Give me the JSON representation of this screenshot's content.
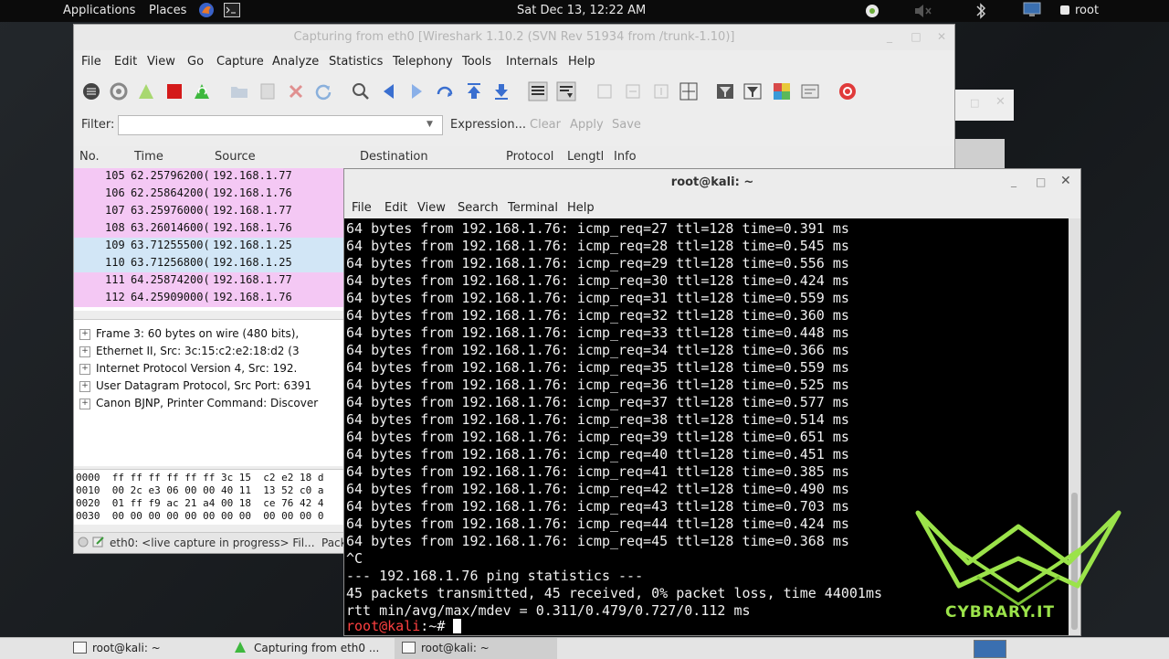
{
  "top_panel": {
    "applications": "Applications",
    "places": "Places",
    "clock": "Sat Dec 13, 12:22 AM",
    "user": "root"
  },
  "wireshark": {
    "title": "Capturing from eth0   [Wireshark 1.10.2  (SVN Rev 51934 from /trunk-1.10)]",
    "menu": [
      "File",
      "Edit",
      "View",
      "Go",
      "Capture",
      "Analyze",
      "Statistics",
      "Telephony",
      "Tools",
      "Internals",
      "Help"
    ],
    "filter_label": "Filter:",
    "filter_value": "",
    "expression_label": "Expression...",
    "clear_label": "Clear",
    "apply_label": "Apply",
    "save_label": "Save",
    "columns": [
      "No.",
      "Time",
      "Source",
      "Destination",
      "Protocol",
      "Lengtl",
      "Info"
    ],
    "packets": [
      {
        "no": "105",
        "time": "62.25796200(",
        "source": "192.168.1.77",
        "color": "#f4c8f4"
      },
      {
        "no": "106",
        "time": "62.25864200(",
        "source": "192.168.1.76",
        "color": "#f4c8f4"
      },
      {
        "no": "107",
        "time": "63.25976000(",
        "source": "192.168.1.77",
        "color": "#f4c8f4"
      },
      {
        "no": "108",
        "time": "63.26014600(",
        "source": "192.168.1.76",
        "color": "#f4c8f4"
      },
      {
        "no": "109",
        "time": "63.71255500(",
        "source": "192.168.1.25",
        "color": "#d2e6f6"
      },
      {
        "no": "110",
        "time": "63.71256800(",
        "source": "192.168.1.25",
        "color": "#d2e6f6"
      },
      {
        "no": "111",
        "time": "64.25874200(",
        "source": "192.168.1.77",
        "color": "#f4c8f4"
      },
      {
        "no": "112",
        "time": "64.25909000(",
        "source": "192.168.1.76",
        "color": "#f4c8f4"
      }
    ],
    "details": [
      "Frame 3: 60 bytes on wire (480 bits),",
      "Ethernet II, Src: 3c:15:c2:e2:18:d2 (3",
      "Internet Protocol Version 4, Src: 192.",
      "User Datagram Protocol, Src Port: 6391",
      "Canon BJNP, Printer Command: Discover"
    ],
    "bytes": [
      "0000  ff ff ff ff ff ff 3c 15  c2 e2 18 d",
      "0010  00 2c e3 06 00 00 40 11  13 52 c0 a",
      "0020  01 ff f9 ac 21 a4 00 18  ce 76 42 4",
      "0030  00 00 00 00 00 00 00 00  00 00 00 0"
    ],
    "status": "eth0: <live capture in progress> Fil...",
    "status_right": "Pack"
  },
  "terminal": {
    "title": "root@kali: ~",
    "menu": [
      "File",
      "Edit",
      "View",
      "Search",
      "Terminal",
      "Help"
    ],
    "lines": [
      "64 bytes from 192.168.1.76: icmp_req=27 ttl=128 time=0.391 ms",
      "64 bytes from 192.168.1.76: icmp_req=28 ttl=128 time=0.545 ms",
      "64 bytes from 192.168.1.76: icmp_req=29 ttl=128 time=0.556 ms",
      "64 bytes from 192.168.1.76: icmp_req=30 ttl=128 time=0.424 ms",
      "64 bytes from 192.168.1.76: icmp_req=31 ttl=128 time=0.559 ms",
      "64 bytes from 192.168.1.76: icmp_req=32 ttl=128 time=0.360 ms",
      "64 bytes from 192.168.1.76: icmp_req=33 ttl=128 time=0.448 ms",
      "64 bytes from 192.168.1.76: icmp_req=34 ttl=128 time=0.366 ms",
      "64 bytes from 192.168.1.76: icmp_req=35 ttl=128 time=0.559 ms",
      "64 bytes from 192.168.1.76: icmp_req=36 ttl=128 time=0.525 ms",
      "64 bytes from 192.168.1.76: icmp_req=37 ttl=128 time=0.577 ms",
      "64 bytes from 192.168.1.76: icmp_req=38 ttl=128 time=0.514 ms",
      "64 bytes from 192.168.1.76: icmp_req=39 ttl=128 time=0.651 ms",
      "64 bytes from 192.168.1.76: icmp_req=40 ttl=128 time=0.451 ms",
      "64 bytes from 192.168.1.76: icmp_req=41 ttl=128 time=0.385 ms",
      "64 bytes from 192.168.1.76: icmp_req=42 ttl=128 time=0.490 ms",
      "64 bytes from 192.168.1.76: icmp_req=43 ttl=128 time=0.703 ms",
      "64 bytes from 192.168.1.76: icmp_req=44 ttl=128 time=0.424 ms",
      "64 bytes from 192.168.1.76: icmp_req=45 ttl=128 time=0.368 ms",
      "^C",
      "--- 192.168.1.76 ping statistics ---",
      "45 packets transmitted, 45 received, 0% packet loss, time 44001ms",
      "rtt min/avg/max/mdev = 0.311/0.479/0.727/0.112 ms"
    ],
    "prompt_user": "root@kali",
    "prompt_suffix": ":~# "
  },
  "logo_text": "CYBRARY.IT",
  "taskbar": {
    "items": [
      "root@kali: ~",
      "Capturing from eth0   ...",
      "root@kali: ~"
    ]
  },
  "colors": {
    "prompt": "#ff4040",
    "logo": "#9be34a",
    "packet_pink": "#f4c8f4",
    "packet_blue": "#d2e6f6"
  }
}
